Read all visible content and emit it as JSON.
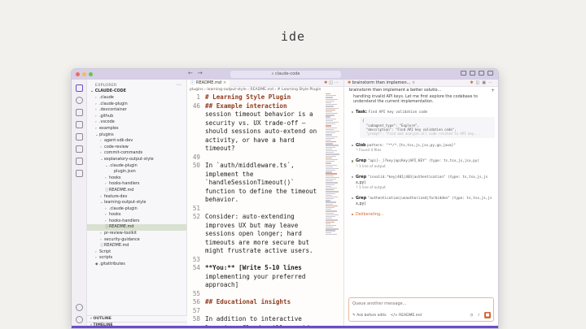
{
  "slide": {
    "title": "ide"
  },
  "window": {
    "search_text": "claude-code",
    "traffic_colors": [
      "#ee6a5f",
      "#f5bd4f",
      "#61c554"
    ]
  },
  "sidebar": {
    "header": "EXPLORER",
    "root": "CLAUDE-CODE",
    "items": [
      {
        "label": ".claude",
        "chev": "›",
        "depth": 1,
        "selected": false
      },
      {
        "label": ".claude-plugin",
        "chev": "›",
        "depth": 1,
        "selected": false
      },
      {
        "label": ".devcontainer",
        "chev": "›",
        "depth": 1,
        "selected": false
      },
      {
        "label": ".github",
        "chev": "›",
        "depth": 1,
        "selected": false
      },
      {
        "label": ".vscode",
        "chev": "›",
        "depth": 1,
        "selected": false
      },
      {
        "label": "examples",
        "chev": "›",
        "depth": 1,
        "selected": false
      },
      {
        "label": "plugins",
        "chev": "⌄",
        "depth": 1,
        "selected": false
      },
      {
        "label": "agent-sdk-dev",
        "chev": "›",
        "depth": 2,
        "selected": false
      },
      {
        "label": "code-review",
        "chev": "›",
        "depth": 2,
        "selected": false
      },
      {
        "label": "commit-commands",
        "chev": "›",
        "depth": 2,
        "selected": false
      },
      {
        "label": "explanatory-output-style",
        "chev": "⌄",
        "depth": 2,
        "selected": false
      },
      {
        "label": ".claude-plugin",
        "chev": "⌄",
        "depth": 3,
        "selected": false
      },
      {
        "label": "plugin.json",
        "chev": "",
        "depth": 4,
        "selected": false
      },
      {
        "label": "hooks",
        "chev": "›",
        "depth": 3,
        "selected": false
      },
      {
        "label": "hooks-handlers",
        "chev": "›",
        "depth": 3,
        "selected": false
      },
      {
        "label": "README.md",
        "chev": "ⓘ",
        "depth": 3,
        "selected": false
      },
      {
        "label": "feature-dev",
        "chev": "›",
        "depth": 2,
        "selected": false
      },
      {
        "label": "learning-output-style",
        "chev": "⌄",
        "depth": 2,
        "selected": false
      },
      {
        "label": ".claude-plugin",
        "chev": "›",
        "depth": 3,
        "selected": false
      },
      {
        "label": "hooks",
        "chev": "›",
        "depth": 3,
        "selected": false
      },
      {
        "label": "hooks-handlers",
        "chev": "›",
        "depth": 3,
        "selected": false
      },
      {
        "label": "README.md",
        "chev": "ⓘ",
        "depth": 3,
        "selected": true
      },
      {
        "label": "pr-review-toolkit",
        "chev": "›",
        "depth": 2,
        "selected": false
      },
      {
        "label": "security-guidance",
        "chev": "›",
        "depth": 2,
        "selected": false
      },
      {
        "label": "README.md",
        "chev": "ⓘ",
        "depth": 2,
        "selected": false
      },
      {
        "label": "Script",
        "chev": "›",
        "depth": 1,
        "selected": false
      },
      {
        "label": "scripts",
        "chev": "›",
        "depth": 1,
        "selected": false
      },
      {
        "label": ".gitattributes",
        "chev": "◆",
        "depth": 1,
        "selected": false
      }
    ],
    "outline": "OUTLINE",
    "timeline": "TIMELINE"
  },
  "editor": {
    "tab_label": "README.md",
    "breadcrumb": "plugins › learning-output-style › README.md › # Learning Style Plugin",
    "lines": [
      {
        "n": "1",
        "text": "# Learning Style Plugin",
        "style": "head"
      },
      {
        "n": "46",
        "text": "## Example interaction",
        "style": "head"
      },
      {
        "n": "",
        "text": "session timeout behavior is a",
        "style": ""
      },
      {
        "n": "",
        "text": "security vs. UX trade-off –",
        "style": ""
      },
      {
        "n": "",
        "text": "should sessions auto-extend on",
        "style": ""
      },
      {
        "n": "",
        "text": "activity, or have a hard",
        "style": ""
      },
      {
        "n": "",
        "text": "timeout?",
        "style": ""
      },
      {
        "n": "49",
        "text": "",
        "style": ""
      },
      {
        "n": "50",
        "text": "In `auth/middleware.ts`,",
        "style": ""
      },
      {
        "n": "",
        "text": "implement the",
        "style": ""
      },
      {
        "n": "",
        "text": "`handleSessionTimeout()`",
        "style": ""
      },
      {
        "n": "",
        "text": "function to define the timeout",
        "style": ""
      },
      {
        "n": "",
        "text": "behavior.",
        "style": ""
      },
      {
        "n": "51",
        "text": "",
        "style": ""
      },
      {
        "n": "52",
        "text": "Consider: auto-extending",
        "style": ""
      },
      {
        "n": "",
        "text": "improves UX but may leave",
        "style": ""
      },
      {
        "n": "",
        "text": "sessions open longer; hard",
        "style": ""
      },
      {
        "n": "",
        "text": "timeouts are more secure but",
        "style": ""
      },
      {
        "n": "",
        "text": "might frustrate active users.",
        "style": ""
      },
      {
        "n": "53",
        "text": "",
        "style": ""
      },
      {
        "n": "54",
        "text": "**You:** [Write 5-10 lines",
        "style": "bold"
      },
      {
        "n": "",
        "text": "implementing your preferred",
        "style": ""
      },
      {
        "n": "",
        "text": "approach]",
        "style": ""
      },
      {
        "n": "55",
        "text": "",
        "style": ""
      },
      {
        "n": "56",
        "text": "## Educational insights",
        "style": "head"
      },
      {
        "n": "57",
        "text": "",
        "style": ""
      },
      {
        "n": "58",
        "text": "In addition to interactive",
        "style": ""
      },
      {
        "n": "",
        "text": "learning, Claude will provide",
        "style": ""
      }
    ]
  },
  "chat": {
    "tab_label": "brainstorm then implemen...",
    "title": "brainstorm then implement a better solutio...",
    "intro": "handling invalid API keys. Let me first explore the codebase to understand the current implementation.",
    "task": {
      "label": "Task:",
      "detail": "Find API key validation code",
      "box": [
        "{",
        "  \"subagent_type\": \"Explore\",",
        "  \"description\": \"Find API key validation code\","
      ],
      "box_fade": "  \"prompt\": \"Find and analyze all code related to API key..."
    },
    "steps": [
      {
        "tool": "Glob",
        "args": "pattern: \"**/*.{ts,tsx,js,jsx,py,go,java}\"",
        "result": "└ Found 4 files"
      },
      {
        "tool": "Grep",
        "args": "\"api[-_]?key|apiKey|API_KEY\" (type: ts,tsx,js,jsx,py)",
        "result": "└ 1 line of output"
      },
      {
        "tool": "Grep",
        "args": "\"invalid.*key|401|403|authentication\" (type: ts,tsx,js,js",
        "args2": "x,py)",
        "result": "└ 1 line of output"
      },
      {
        "tool": "Grep",
        "args": "\"authentication|unauthorized|forbidden\" (type: ts,tsx,js,js",
        "args2": "x,py)",
        "result": ""
      }
    ],
    "status": "Deliberating...",
    "composer_placeholder": "Queue another message...",
    "mode_label": "Ask before edits",
    "file_label": "README.md"
  }
}
